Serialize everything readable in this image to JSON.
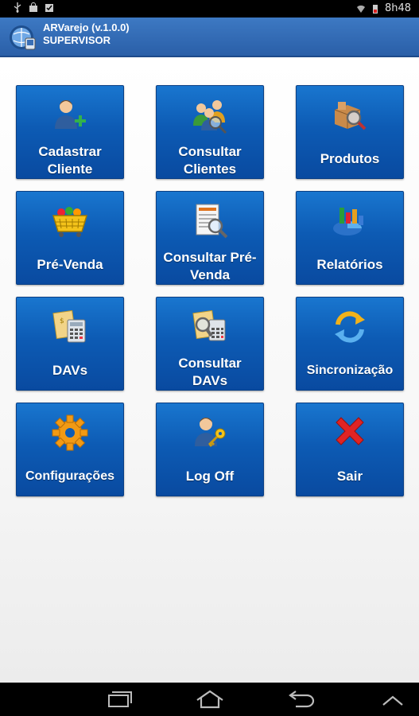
{
  "status_bar": {
    "time": "8h48"
  },
  "app": {
    "title": "ARVarejo (v.1.0.0)",
    "subtitle": "SUPERVISOR"
  },
  "menu": {
    "tiles": [
      {
        "line1": "Cadastrar",
        "line2": "Cliente",
        "icon": "add-user-icon"
      },
      {
        "line1": "Consultar",
        "line2": "Clientes",
        "icon": "search-users-icon"
      },
      {
        "line1": "Produtos",
        "line2": "",
        "icon": "product-search-icon"
      },
      {
        "line1": "Pré-Venda",
        "line2": "",
        "icon": "shopping-basket-icon"
      },
      {
        "line1": "Consultar Pré-",
        "line2": "Venda",
        "icon": "document-search-icon"
      },
      {
        "line1": "Relatórios",
        "line2": "",
        "icon": "chart-icon"
      },
      {
        "line1": "DAVs",
        "line2": "",
        "icon": "calculator-document-icon"
      },
      {
        "line1": "Consultar",
        "line2": "DAVs",
        "icon": "calculator-search-icon"
      },
      {
        "line1": "Sincronização",
        "line2": "",
        "icon": "sync-icon"
      },
      {
        "line1": "Configurações",
        "line2": "",
        "icon": "gear-icon"
      },
      {
        "line1": "Log Off",
        "line2": "",
        "icon": "user-key-icon"
      },
      {
        "line1": "Sair",
        "line2": "",
        "icon": "close-icon"
      }
    ]
  },
  "colors": {
    "action_bar": "#2f69b3",
    "tile": "#0d5bb4",
    "tile_text": "#ffffff"
  }
}
